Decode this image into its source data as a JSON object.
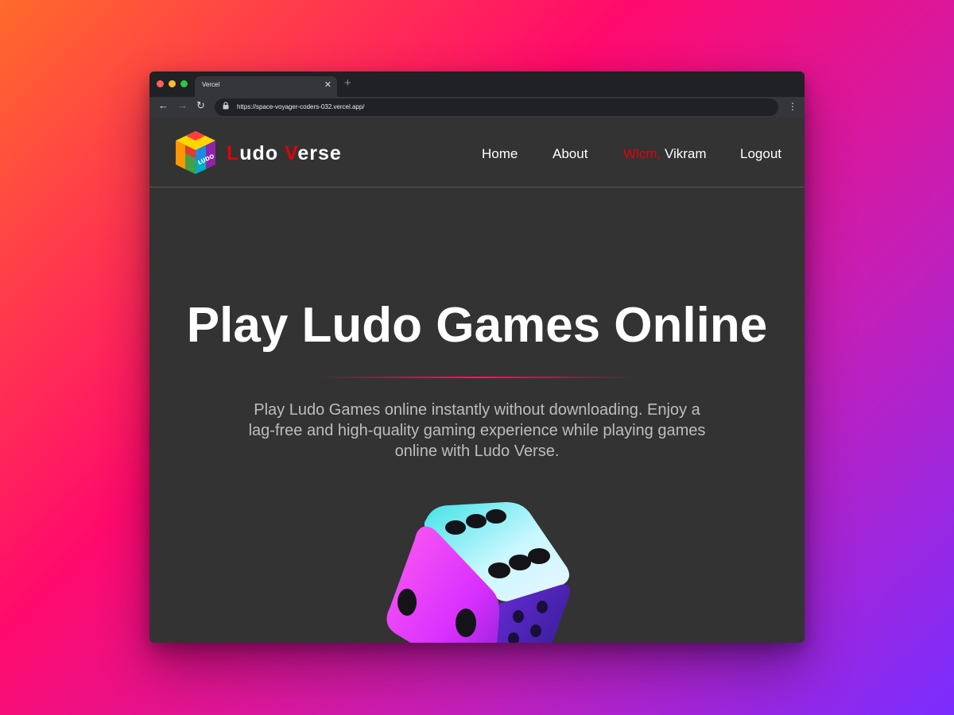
{
  "browser": {
    "tab_title": "Vercel",
    "tab_close_icon": "close-icon",
    "new_tab_icon": "plus-icon",
    "url": "https://space-voyager-coders-032.vercel.app/",
    "lock_icon": "lock-icon",
    "menu_icon": "more-vertical-icon"
  },
  "site": {
    "brand": {
      "first_initial": "L",
      "first_rest": "udo",
      "second_initial": "V",
      "second_rest": "erse"
    },
    "nav": {
      "home": "Home",
      "about": "About",
      "welcome_prefix": "Wlcm,",
      "user_name": "Vikram",
      "logout": "Logout"
    },
    "hero": {
      "title": "Play Ludo Games Online",
      "description": "Play Ludo Games online instantly without downloading. Enjoy a lag-free and high-quality gaming experience while playing games online with Ludo Verse."
    },
    "colors": {
      "accent_red": "#e0000c",
      "divider_pink": "#e91e63",
      "page_background": "#333333"
    }
  }
}
